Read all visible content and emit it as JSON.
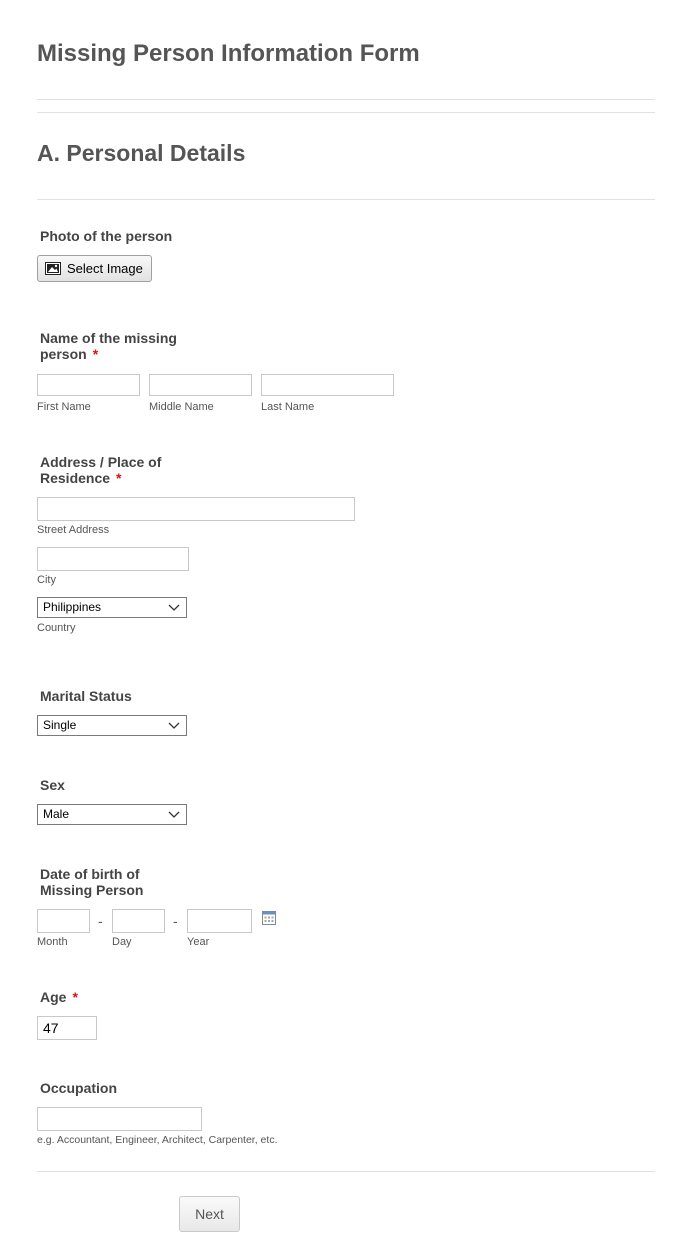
{
  "form": {
    "title": "Missing Person Information Form",
    "section_title": "A. Personal Details"
  },
  "photo": {
    "label": "Photo of the person",
    "button_label": "Select Image",
    "button_icon": "image-icon"
  },
  "name": {
    "label_line1": "Name of the missing",
    "label_line2": "person",
    "required_mark": "*",
    "first_name": {
      "value": "",
      "sublabel": "First Name"
    },
    "middle_name": {
      "value": "",
      "sublabel": "Middle Name"
    },
    "last_name": {
      "value": "",
      "sublabel": "Last Name"
    }
  },
  "address": {
    "label_line1": "Address / Place of",
    "label_line2": "Residence",
    "required_mark": "*",
    "street": {
      "value": "",
      "sublabel": "Street Address"
    },
    "city": {
      "value": "",
      "sublabel": "City"
    },
    "country": {
      "selected": "Philippines",
      "sublabel": "Country"
    }
  },
  "marital_status": {
    "label": "Marital Status",
    "selected": "Single"
  },
  "sex": {
    "label": "Sex",
    "selected": "Male"
  },
  "dob": {
    "label_line1": "Date of birth of",
    "label_line2": "Missing Person",
    "separator": "-",
    "month": {
      "value": "",
      "sublabel": "Month"
    },
    "day": {
      "value": "",
      "sublabel": "Day"
    },
    "year": {
      "value": "",
      "sublabel": "Year"
    },
    "calendar_icon": "calendar-icon"
  },
  "age": {
    "label": "Age",
    "required_mark": "*",
    "value": "47"
  },
  "occupation": {
    "label": "Occupation",
    "value": "",
    "hint": "e.g. Accountant, Engineer, Architect, Carpenter, etc."
  },
  "nav": {
    "next_label": "Next"
  },
  "colors": {
    "required": "#dd1111",
    "heading": "#555555",
    "divider": "#e1e1e1"
  }
}
